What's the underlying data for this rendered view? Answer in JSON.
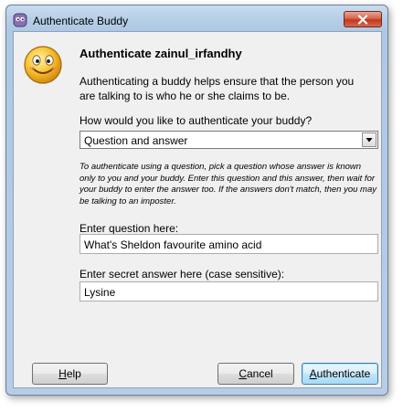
{
  "window": {
    "title": "Authenticate Buddy"
  },
  "dialog": {
    "heading": "Authenticate zainul_irfandhy",
    "intro": "Authenticating a buddy helps ensure that the person you are talking to is who he or she claims to be.",
    "method_label": "How would you like to authenticate your buddy?",
    "method_selected": "Question and answer",
    "help_text": "To authenticate using a question, pick a question whose answer is known only to you and your buddy.  Enter this question and this answer, then wait for your buddy to enter the answer too.  If the answers don't match, then you may be talking to an imposter.",
    "question_label": "Enter question here:",
    "question_value": "What's Sheldon favourite amino acid",
    "answer_label": "Enter secret answer here (case sensitive):",
    "answer_value": "Lysine"
  },
  "buttons": {
    "help_first": "H",
    "help_rest": "elp",
    "cancel_first": "C",
    "cancel_rest": "ancel",
    "auth_first": "A",
    "auth_rest": "uthenticate"
  },
  "icons": {
    "title_icon": "pidgin-icon",
    "dialog_icon": "smiley-face-icon",
    "close_icon": "close-icon",
    "dropdown_icon": "chevron-down-icon"
  },
  "colors": {
    "titlebar": "#b7cfe7",
    "close_button": "#c0391f",
    "default_button_border": "#3c7fb1",
    "dialog_background": "#f0f0f0"
  }
}
